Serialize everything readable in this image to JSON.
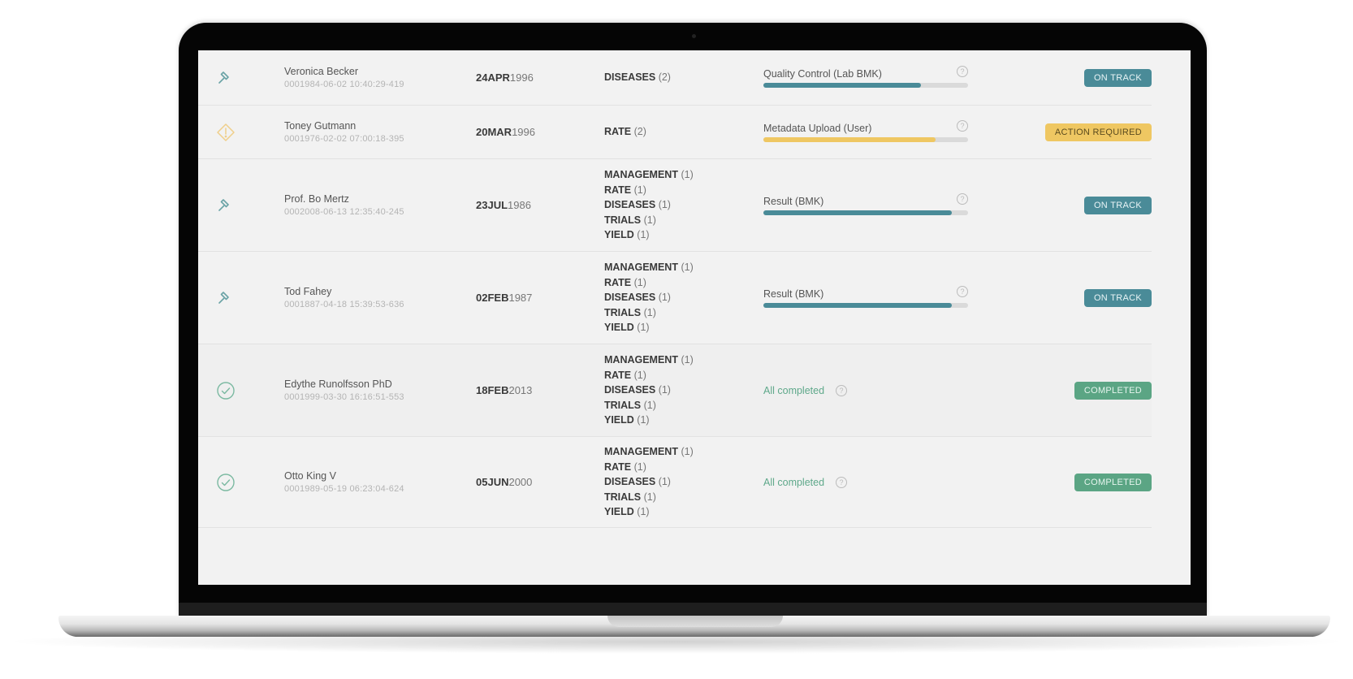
{
  "colors": {
    "on_track": "#4a8b98",
    "action_required": "#efc762",
    "completed": "#5ba584",
    "progress_track": "#dadada"
  },
  "rows": [
    {
      "icon": "wrench-icon",
      "name": "Veronica Becker",
      "id": "0001984-06-02 10:40:29-419",
      "date_bold": "24APR",
      "date_year": "1996",
      "categories": [
        {
          "label": "DISEASES",
          "count": "(2)"
        }
      ],
      "progress_label": "Quality Control (Lab BMK)",
      "progress": 0.77,
      "progress_color": "#4a8b98",
      "status": "ON TRACK",
      "status_type": "on-track"
    },
    {
      "icon": "warning-diamond-icon",
      "name": "Toney Gutmann",
      "id": "0001976-02-02 07:00:18-395",
      "date_bold": "20MAR",
      "date_year": "1996",
      "categories": [
        {
          "label": "RATE",
          "count": "(2)"
        }
      ],
      "progress_label": "Metadata Upload (User)",
      "progress": 0.84,
      "progress_color": "#efc762",
      "status": "ACTION REQUIRED",
      "status_type": "action"
    },
    {
      "icon": "wrench-icon",
      "name": "Prof. Bo Mertz",
      "id": "0002008-06-13 12:35:40-245",
      "date_bold": "23JUL",
      "date_year": "1986",
      "categories": [
        {
          "label": "MANAGEMENT",
          "count": "(1)"
        },
        {
          "label": "RATE",
          "count": "(1)"
        },
        {
          "label": "DISEASES",
          "count": "(1)"
        },
        {
          "label": "TRIALS",
          "count": "(1)"
        },
        {
          "label": "YIELD",
          "count": "(1)"
        }
      ],
      "progress_label": "Result (BMK)",
      "progress": 0.92,
      "progress_color": "#4a8b98",
      "status": "ON TRACK",
      "status_type": "on-track"
    },
    {
      "icon": "wrench-icon",
      "name": "Tod Fahey",
      "id": "0001887-04-18 15:39:53-636",
      "date_bold": "02FEB",
      "date_year": "1987",
      "categories": [
        {
          "label": "MANAGEMENT",
          "count": "(1)"
        },
        {
          "label": "RATE",
          "count": "(1)"
        },
        {
          "label": "DISEASES",
          "count": "(1)"
        },
        {
          "label": "TRIALS",
          "count": "(1)"
        },
        {
          "label": "YIELD",
          "count": "(1)"
        }
      ],
      "progress_label": "Result (BMK)",
      "progress": 0.92,
      "progress_color": "#4a8b98",
      "status": "ON TRACK",
      "status_type": "on-track"
    },
    {
      "icon": "check-circle-icon",
      "name": "Edythe Runolfsson PhD",
      "id": "0001999-03-30 16:16:51-553",
      "date_bold": "18FEB",
      "date_year": "2013",
      "categories": [
        {
          "label": "MANAGEMENT",
          "count": "(1)"
        },
        {
          "label": "RATE",
          "count": "(1)"
        },
        {
          "label": "DISEASES",
          "count": "(1)"
        },
        {
          "label": "TRIALS",
          "count": "(1)"
        },
        {
          "label": "YIELD",
          "count": "(1)"
        }
      ],
      "progress_label": "All completed",
      "progress": null,
      "status": "COMPLETED",
      "status_type": "completed"
    },
    {
      "icon": "check-circle-icon",
      "name": "Otto King V",
      "id": "0001989-05-19 06:23:04-624",
      "date_bold": "05JUN",
      "date_year": "2000",
      "categories": [
        {
          "label": "MANAGEMENT",
          "count": "(1)"
        },
        {
          "label": "RATE",
          "count": "(1)"
        },
        {
          "label": "DISEASES",
          "count": "(1)"
        },
        {
          "label": "TRIALS",
          "count": "(1)"
        },
        {
          "label": "YIELD",
          "count": "(1)"
        }
      ],
      "progress_label": "All completed",
      "progress": null,
      "status": "COMPLETED",
      "status_type": "completed"
    }
  ],
  "help_glyph": "?"
}
